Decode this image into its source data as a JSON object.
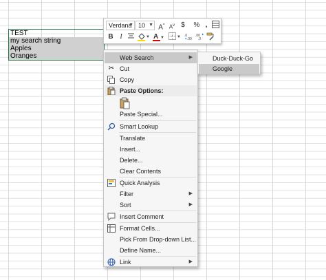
{
  "cells": [
    {
      "text": "TEST"
    },
    {
      "text": "my search string"
    },
    {
      "text": "Apples"
    },
    {
      "text": "Oranges"
    }
  ],
  "mini_toolbar": {
    "font_name": "Verdana",
    "font_size": "10",
    "grow": "A",
    "shrink": "A",
    "currency": "$",
    "percent": "%",
    "comma": ",",
    "bold": "B",
    "italic": "I",
    "font_color": "A"
  },
  "context_menu": {
    "items": [
      {
        "label": "Web Search"
      },
      {
        "label": "Cut"
      },
      {
        "label": "Copy"
      },
      {
        "label": "Paste Options:"
      },
      {
        "label": "Paste Special..."
      },
      {
        "label": "Smart Lookup"
      },
      {
        "label": "Translate"
      },
      {
        "label": "Insert..."
      },
      {
        "label": "Delete..."
      },
      {
        "label": "Clear Contents"
      },
      {
        "label": "Quick Analysis"
      },
      {
        "label": "Filter"
      },
      {
        "label": "Sort"
      },
      {
        "label": "Insert Comment"
      },
      {
        "label": "Format Cells..."
      },
      {
        "label": "Pick From Drop-down List..."
      },
      {
        "label": "Define Name..."
      },
      {
        "label": "Link"
      }
    ]
  },
  "submenu": {
    "items": [
      {
        "label": "Duck-Duck-Go"
      },
      {
        "label": "Google"
      }
    ]
  },
  "colors": {
    "selection_border": "#217346",
    "selection_fill": "#d0d0d0",
    "highlight": "#c9c9c9",
    "menu_bg": "#f6f6f6"
  },
  "icons": {
    "cut": "scissors-icon",
    "copy": "copy-icon",
    "paste": "paste-clipboard-icon",
    "smart_lookup": "search-icon",
    "quick_analysis": "quick-analysis-icon",
    "insert_comment": "comment-icon",
    "format_cells": "format-cells-icon",
    "link": "link-icon"
  }
}
